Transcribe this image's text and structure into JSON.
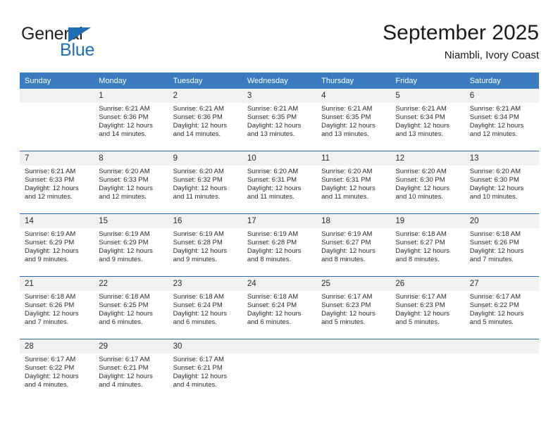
{
  "brand": {
    "line1": "General",
    "line2": "Blue",
    "triangle_icon": "triangle-icon"
  },
  "header": {
    "title": "September 2025",
    "subtitle": "Niambli, Ivory Coast"
  },
  "colors": {
    "header_blue": "#3b7cc0",
    "separator_blue": "#2c6cad",
    "daynum_band": "#f1f1f1",
    "brand_blue": "#1e6db5",
    "text": "#2b2b2b"
  },
  "calendar": {
    "weekday_headers": [
      "Sunday",
      "Monday",
      "Tuesday",
      "Wednesday",
      "Thursday",
      "Friday",
      "Saturday"
    ],
    "weeks": [
      [
        {
          "day": "",
          "sunrise": "",
          "sunset": "",
          "daylight_1": "",
          "daylight_2": ""
        },
        {
          "day": "1",
          "sunrise": "Sunrise: 6:21 AM",
          "sunset": "Sunset: 6:36 PM",
          "daylight_1": "Daylight: 12 hours",
          "daylight_2": "and 14 minutes."
        },
        {
          "day": "2",
          "sunrise": "Sunrise: 6:21 AM",
          "sunset": "Sunset: 6:36 PM",
          "daylight_1": "Daylight: 12 hours",
          "daylight_2": "and 14 minutes."
        },
        {
          "day": "3",
          "sunrise": "Sunrise: 6:21 AM",
          "sunset": "Sunset: 6:35 PM",
          "daylight_1": "Daylight: 12 hours",
          "daylight_2": "and 13 minutes."
        },
        {
          "day": "4",
          "sunrise": "Sunrise: 6:21 AM",
          "sunset": "Sunset: 6:35 PM",
          "daylight_1": "Daylight: 12 hours",
          "daylight_2": "and 13 minutes."
        },
        {
          "day": "5",
          "sunrise": "Sunrise: 6:21 AM",
          "sunset": "Sunset: 6:34 PM",
          "daylight_1": "Daylight: 12 hours",
          "daylight_2": "and 13 minutes."
        },
        {
          "day": "6",
          "sunrise": "Sunrise: 6:21 AM",
          "sunset": "Sunset: 6:34 PM",
          "daylight_1": "Daylight: 12 hours",
          "daylight_2": "and 12 minutes."
        }
      ],
      [
        {
          "day": "7",
          "sunrise": "Sunrise: 6:21 AM",
          "sunset": "Sunset: 6:33 PM",
          "daylight_1": "Daylight: 12 hours",
          "daylight_2": "and 12 minutes."
        },
        {
          "day": "8",
          "sunrise": "Sunrise: 6:20 AM",
          "sunset": "Sunset: 6:33 PM",
          "daylight_1": "Daylight: 12 hours",
          "daylight_2": "and 12 minutes."
        },
        {
          "day": "9",
          "sunrise": "Sunrise: 6:20 AM",
          "sunset": "Sunset: 6:32 PM",
          "daylight_1": "Daylight: 12 hours",
          "daylight_2": "and 11 minutes."
        },
        {
          "day": "10",
          "sunrise": "Sunrise: 6:20 AM",
          "sunset": "Sunset: 6:31 PM",
          "daylight_1": "Daylight: 12 hours",
          "daylight_2": "and 11 minutes."
        },
        {
          "day": "11",
          "sunrise": "Sunrise: 6:20 AM",
          "sunset": "Sunset: 6:31 PM",
          "daylight_1": "Daylight: 12 hours",
          "daylight_2": "and 11 minutes."
        },
        {
          "day": "12",
          "sunrise": "Sunrise: 6:20 AM",
          "sunset": "Sunset: 6:30 PM",
          "daylight_1": "Daylight: 12 hours",
          "daylight_2": "and 10 minutes."
        },
        {
          "day": "13",
          "sunrise": "Sunrise: 6:20 AM",
          "sunset": "Sunset: 6:30 PM",
          "daylight_1": "Daylight: 12 hours",
          "daylight_2": "and 10 minutes."
        }
      ],
      [
        {
          "day": "14",
          "sunrise": "Sunrise: 6:19 AM",
          "sunset": "Sunset: 6:29 PM",
          "daylight_1": "Daylight: 12 hours",
          "daylight_2": "and 9 minutes."
        },
        {
          "day": "15",
          "sunrise": "Sunrise: 6:19 AM",
          "sunset": "Sunset: 6:29 PM",
          "daylight_1": "Daylight: 12 hours",
          "daylight_2": "and 9 minutes."
        },
        {
          "day": "16",
          "sunrise": "Sunrise: 6:19 AM",
          "sunset": "Sunset: 6:28 PM",
          "daylight_1": "Daylight: 12 hours",
          "daylight_2": "and 9 minutes."
        },
        {
          "day": "17",
          "sunrise": "Sunrise: 6:19 AM",
          "sunset": "Sunset: 6:28 PM",
          "daylight_1": "Daylight: 12 hours",
          "daylight_2": "and 8 minutes."
        },
        {
          "day": "18",
          "sunrise": "Sunrise: 6:19 AM",
          "sunset": "Sunset: 6:27 PM",
          "daylight_1": "Daylight: 12 hours",
          "daylight_2": "and 8 minutes."
        },
        {
          "day": "19",
          "sunrise": "Sunrise: 6:18 AM",
          "sunset": "Sunset: 6:27 PM",
          "daylight_1": "Daylight: 12 hours",
          "daylight_2": "and 8 minutes."
        },
        {
          "day": "20",
          "sunrise": "Sunrise: 6:18 AM",
          "sunset": "Sunset: 6:26 PM",
          "daylight_1": "Daylight: 12 hours",
          "daylight_2": "and 7 minutes."
        }
      ],
      [
        {
          "day": "21",
          "sunrise": "Sunrise: 6:18 AM",
          "sunset": "Sunset: 6:26 PM",
          "daylight_1": "Daylight: 12 hours",
          "daylight_2": "and 7 minutes."
        },
        {
          "day": "22",
          "sunrise": "Sunrise: 6:18 AM",
          "sunset": "Sunset: 6:25 PM",
          "daylight_1": "Daylight: 12 hours",
          "daylight_2": "and 6 minutes."
        },
        {
          "day": "23",
          "sunrise": "Sunrise: 6:18 AM",
          "sunset": "Sunset: 6:24 PM",
          "daylight_1": "Daylight: 12 hours",
          "daylight_2": "and 6 minutes."
        },
        {
          "day": "24",
          "sunrise": "Sunrise: 6:18 AM",
          "sunset": "Sunset: 6:24 PM",
          "daylight_1": "Daylight: 12 hours",
          "daylight_2": "and 6 minutes."
        },
        {
          "day": "25",
          "sunrise": "Sunrise: 6:17 AM",
          "sunset": "Sunset: 6:23 PM",
          "daylight_1": "Daylight: 12 hours",
          "daylight_2": "and 5 minutes."
        },
        {
          "day": "26",
          "sunrise": "Sunrise: 6:17 AM",
          "sunset": "Sunset: 6:23 PM",
          "daylight_1": "Daylight: 12 hours",
          "daylight_2": "and 5 minutes."
        },
        {
          "day": "27",
          "sunrise": "Sunrise: 6:17 AM",
          "sunset": "Sunset: 6:22 PM",
          "daylight_1": "Daylight: 12 hours",
          "daylight_2": "and 5 minutes."
        }
      ],
      [
        {
          "day": "28",
          "sunrise": "Sunrise: 6:17 AM",
          "sunset": "Sunset: 6:22 PM",
          "daylight_1": "Daylight: 12 hours",
          "daylight_2": "and 4 minutes."
        },
        {
          "day": "29",
          "sunrise": "Sunrise: 6:17 AM",
          "sunset": "Sunset: 6:21 PM",
          "daylight_1": "Daylight: 12 hours",
          "daylight_2": "and 4 minutes."
        },
        {
          "day": "30",
          "sunrise": "Sunrise: 6:17 AM",
          "sunset": "Sunset: 6:21 PM",
          "daylight_1": "Daylight: 12 hours",
          "daylight_2": "and 4 minutes."
        },
        {
          "day": "",
          "sunrise": "",
          "sunset": "",
          "daylight_1": "",
          "daylight_2": ""
        },
        {
          "day": "",
          "sunrise": "",
          "sunset": "",
          "daylight_1": "",
          "daylight_2": ""
        },
        {
          "day": "",
          "sunrise": "",
          "sunset": "",
          "daylight_1": "",
          "daylight_2": ""
        },
        {
          "day": "",
          "sunrise": "",
          "sunset": "",
          "daylight_1": "",
          "daylight_2": ""
        }
      ]
    ]
  }
}
